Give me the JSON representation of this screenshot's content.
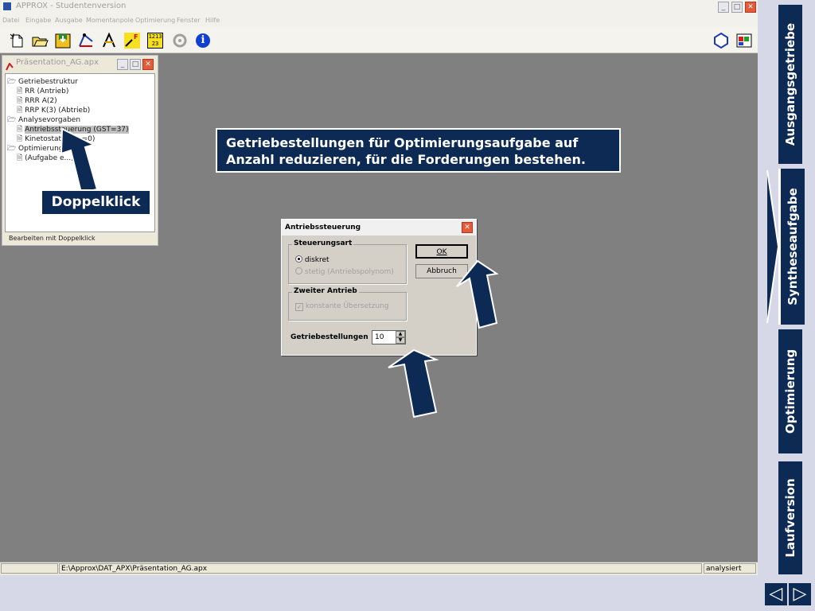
{
  "window": {
    "title": "APPROX - Studentenversion",
    "menu": [
      "Datei",
      "Eingabe",
      "Ausgabe",
      "Momentanpole",
      "Optimierung",
      "Fenster",
      "Hilfe"
    ],
    "controls": {
      "minimize": "_",
      "maximize": "□",
      "close": "✕"
    }
  },
  "toolbar": {
    "icons": [
      "new-document-icon",
      "open-folder-icon",
      "save-icon",
      "mechanism-icon",
      "compass-icon",
      "force-moment-icon",
      "numbers-icon",
      "gear-icon",
      "info-icon"
    ],
    "numbers_icon_text": "1213 23",
    "info_glyph": "i",
    "force_icon_text": "F M"
  },
  "child_window": {
    "title": "Präsentation_AG.apx",
    "tree": [
      {
        "label": "Getriebestruktur",
        "type": "folder",
        "level": 0
      },
      {
        "label": "RR (Antrieb)",
        "type": "doc",
        "level": 1
      },
      {
        "label": "RRR A(2)",
        "type": "doc",
        "level": 1
      },
      {
        "label": "RRP K(3) (Abtrieb)",
        "type": "doc",
        "level": 1
      },
      {
        "label": "Analysevorgaben",
        "type": "folder",
        "level": 0
      },
      {
        "label": "Antriebssteuerung (GST=37)",
        "type": "doc",
        "level": 1,
        "selected": true
      },
      {
        "label": "Kinetostatik (... =0)",
        "type": "doc",
        "level": 1
      },
      {
        "label": "Optimierung",
        "type": "folder",
        "level": 0
      },
      {
        "label": "(Aufgabe e...)",
        "type": "doc",
        "level": 1
      }
    ],
    "status": "Bearbeiten mit Doppelklick"
  },
  "annotations": {
    "doppelklick": "Doppelklick",
    "hint": "Getriebestellungen für Optimierungsaufgabe auf Anzahl reduzieren, für die Forderungen bestehen."
  },
  "dialog": {
    "title": "Antriebssteuerung",
    "group1": {
      "label": "Steuerungsart",
      "options": [
        {
          "label": "diskret",
          "checked": true,
          "enabled": true
        },
        {
          "label": "stetig (Antriebspolynom)",
          "checked": false,
          "enabled": false
        }
      ]
    },
    "group2": {
      "label": "Zweiter Antrieb",
      "checkbox": {
        "label": "konstante Übersetzung",
        "checked": true,
        "enabled": false
      }
    },
    "ok_label": "OK",
    "cancel_label": "Abbruch",
    "spinner_label": "Getriebestellungen",
    "spinner_value": "10"
  },
  "statusbar": {
    "path": "E:\\Approx\\DAT_APX\\Präsentation_AG.apx",
    "state": "analysiert"
  },
  "side_tabs": [
    "Ausgangsgetriebe",
    "Syntheseaufgabe",
    "Optimierung",
    "Laufversion"
  ],
  "side_active": "Syntheseaufgabe",
  "nav": {
    "prev": "◁",
    "next": "▷"
  },
  "colors": {
    "navy": "#0d2a55",
    "workspace": "#808080",
    "dialog": "#d4d0c8",
    "background": "#d6d8e8"
  }
}
